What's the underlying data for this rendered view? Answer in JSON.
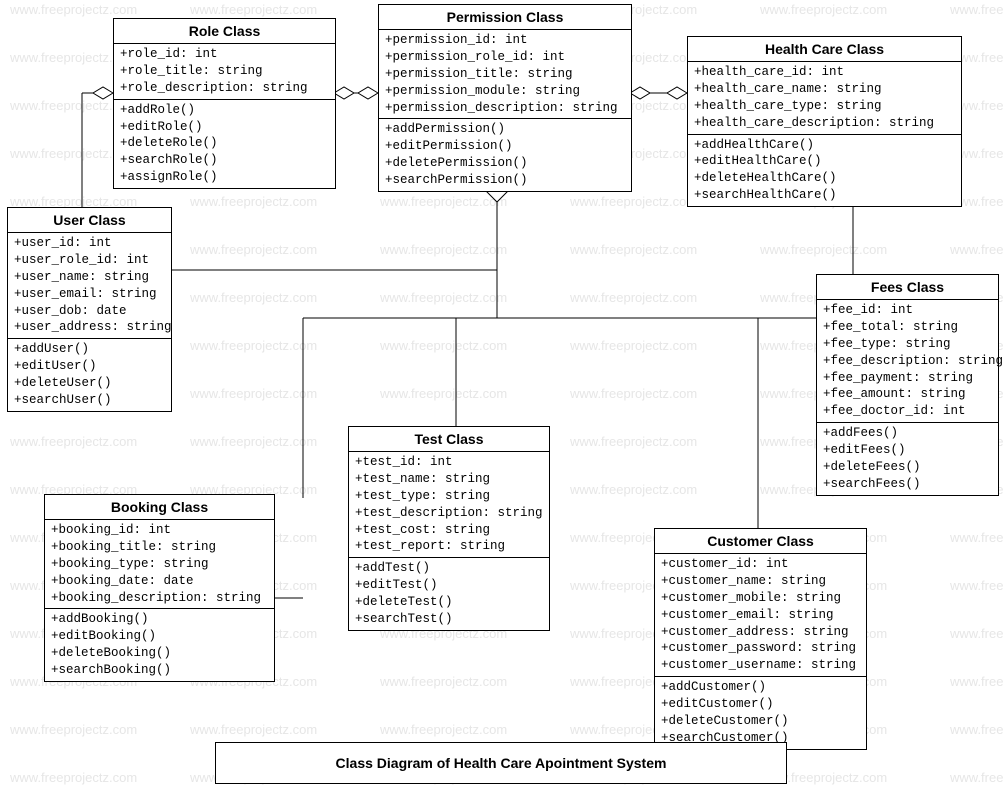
{
  "watermark_text": "www.freeprojectz.com",
  "caption": "Class Diagram of Health Care Apointment System",
  "classes": {
    "role": {
      "title": "Role Class",
      "attrs": [
        "+role_id: int",
        "+role_title: string",
        "+role_description: string"
      ],
      "ops": [
        "+addRole()",
        "+editRole()",
        "+deleteRole()",
        "+searchRole()",
        "+assignRole()"
      ]
    },
    "permission": {
      "title": "Permission Class",
      "attrs": [
        "+permission_id: int",
        "+permission_role_id: int",
        "+permission_title: string",
        "+permission_module: string",
        "+permission_description: string"
      ],
      "ops": [
        "+addPermission()",
        "+editPermission()",
        "+deletePermission()",
        "+searchPermission()"
      ]
    },
    "healthcare": {
      "title": "Health Care Class",
      "attrs": [
        "+health_care_id: int",
        "+health_care_name: string",
        "+health_care_type: string",
        "+health_care_description: string"
      ],
      "ops": [
        "+addHealthCare()",
        "+editHealthCare()",
        "+deleteHealthCare()",
        "+searchHealthCare()"
      ]
    },
    "user": {
      "title": "User Class",
      "attrs": [
        "+user_id: int",
        "+user_role_id: int",
        "+user_name: string",
        "+user_email: string",
        "+user_dob: date",
        "+user_address: string"
      ],
      "ops": [
        "+addUser()",
        "+editUser()",
        "+deleteUser()",
        "+searchUser()"
      ]
    },
    "fees": {
      "title": "Fees Class",
      "attrs": [
        "+fee_id: int",
        "+fee_total: string",
        "+fee_type: string",
        "+fee_description: string",
        "+fee_payment: string",
        "+fee_amount: string",
        "+fee_doctor_id: int"
      ],
      "ops": [
        "+addFees()",
        "+editFees()",
        "+deleteFees()",
        "+searchFees()"
      ]
    },
    "test": {
      "title": "Test Class",
      "attrs": [
        "+test_id: int",
        "+test_name: string",
        "+test_type: string",
        "+test_description: string",
        "+test_cost: string",
        "+test_report: string"
      ],
      "ops": [
        "+addTest()",
        "+editTest()",
        "+deleteTest()",
        "+searchTest()"
      ]
    },
    "booking": {
      "title": "Booking Class",
      "attrs": [
        "+booking_id: int",
        "+booking_title: string",
        "+booking_type: string",
        "+booking_date: date",
        "+booking_description: string"
      ],
      "ops": [
        "+addBooking()",
        "+editBooking()",
        "+deleteBooking()",
        "+searchBooking()"
      ]
    },
    "customer": {
      "title": "Customer Class",
      "attrs": [
        "+customer_id: int",
        "+customer_name: string",
        "+customer_mobile: string",
        "+customer_email: string",
        "+customer_address: string",
        "+customer_password: string",
        "+customer_username: string"
      ],
      "ops": [
        "+addCustomer()",
        "+editCustomer()",
        "+deleteCustomer()",
        "+searchCustomer()"
      ]
    }
  }
}
